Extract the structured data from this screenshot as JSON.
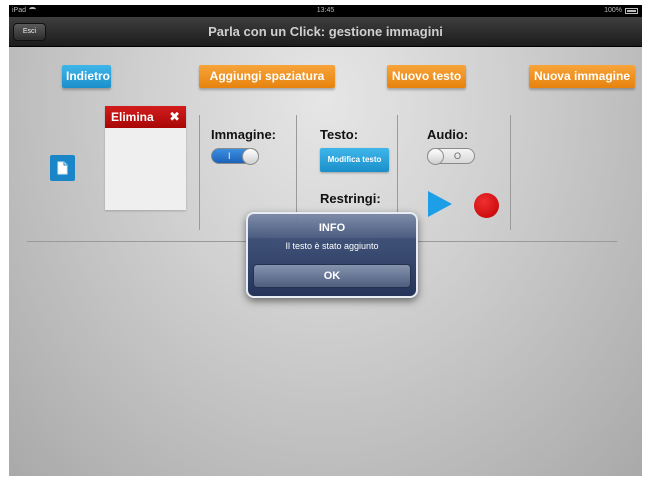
{
  "status_bar": {
    "device": "iPad",
    "time": "13:45",
    "battery": "100%"
  },
  "nav": {
    "title": "Parla con un Click: gestione immagini",
    "back_label": "Esci"
  },
  "toolbar": {
    "back": "Indietro",
    "add_spacing": "Aggiungi spaziatura",
    "new_text": "Nuovo testo",
    "new_image": "Nuova immagine"
  },
  "item": {
    "delete_label": "Elimina",
    "image_label": "Immagine:",
    "image_toggle": {
      "state": "on",
      "mark": "I"
    },
    "text_label": "Testo:",
    "edit_text": "Modifica testo",
    "shrink_label": "Restringi:",
    "audio_label": "Audio:",
    "audio_toggle": {
      "state": "off",
      "mark": "O"
    }
  },
  "alert": {
    "title": "INFO",
    "message": "Il testo è stato aggiunto",
    "ok": "OK"
  },
  "colors": {
    "blue_button": "#1a8fca",
    "orange_button": "#e7830e",
    "delete_red": "#c00000",
    "toggle_on": "#1d62b8"
  },
  "icons": [
    "wifi-icon",
    "battery-icon",
    "document-icon",
    "close-x-icon",
    "play-icon",
    "record-icon"
  ]
}
